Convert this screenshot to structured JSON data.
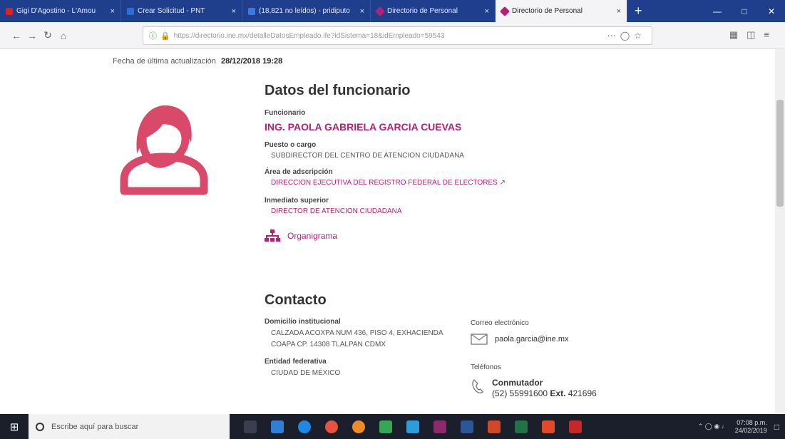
{
  "browser": {
    "tabs": [
      {
        "title": "Gigi D'Agostino - L'Amou",
        "color": "#e02020",
        "active": false
      },
      {
        "title": "Crear Solicitud - PNT",
        "color": "#2a6fd6",
        "active": false
      },
      {
        "title": "(18,821 no leídos) - pridiputo",
        "color": "#3b7be0",
        "active": false
      },
      {
        "title": "Directorio de Personal",
        "color": "#b0217a",
        "active": false
      },
      {
        "title": "Directorio de Personal",
        "color": "#b0217a",
        "active": true
      }
    ],
    "tab_close": "×",
    "new_tab": "+",
    "url": "https://directorio.ine.mx/detalleDatosEmpleado.ife?idSistema=18&idEmpleado=59543"
  },
  "page": {
    "updated_label": "Fecha de última actualización",
    "updated_value": "28/12/2018 19:28",
    "section_funcionario": "Datos del funcionario",
    "funcionario_label": "Funcionario",
    "funcionario_name": "ING. PAOLA GABRIELA GARCIA CUEVAS",
    "puesto_label": "Puesto o cargo",
    "puesto_value": "SUBDIRECTOR DEL CENTRO DE ATENCION CIUDADANA",
    "area_label": "Área de adscripción",
    "area_value": "DIRECCION EJECUTIVA DEL REGISTRO FEDERAL DE ELECTORES",
    "superior_label": "Inmediato superior",
    "superior_value": "DIRECTOR DE ATENCION CIUDADANA",
    "organigrama": "Organigrama",
    "section_contacto": "Contacto",
    "domicilio_label": "Domicilio institucional",
    "domicilio_line1": "CALZADA ACOXPA NUM 436, PISO 4, EXHACIENDA",
    "domicilio_line2": "COAPA CP. 14308 TLALPAN CDMX",
    "entidad_label": "Entidad federativa",
    "entidad_value": "CIUDAD DE MÉXICO",
    "correo_label": "Correo electrónico",
    "correo_value": "paola.garcia@ine.mx",
    "telefonos_label": "Teléfonos",
    "conmutador": "Conmutador",
    "phone_number": "(52) 55991600",
    "ext_label": "Ext.",
    "ext_value": "421696",
    "accent": "#b0217a",
    "avatar_color": "#d94a6a"
  },
  "taskbar": {
    "search_placeholder": "Escribe aquí para buscar",
    "time": "07:08 p.m.",
    "date": "24/02/2019"
  }
}
